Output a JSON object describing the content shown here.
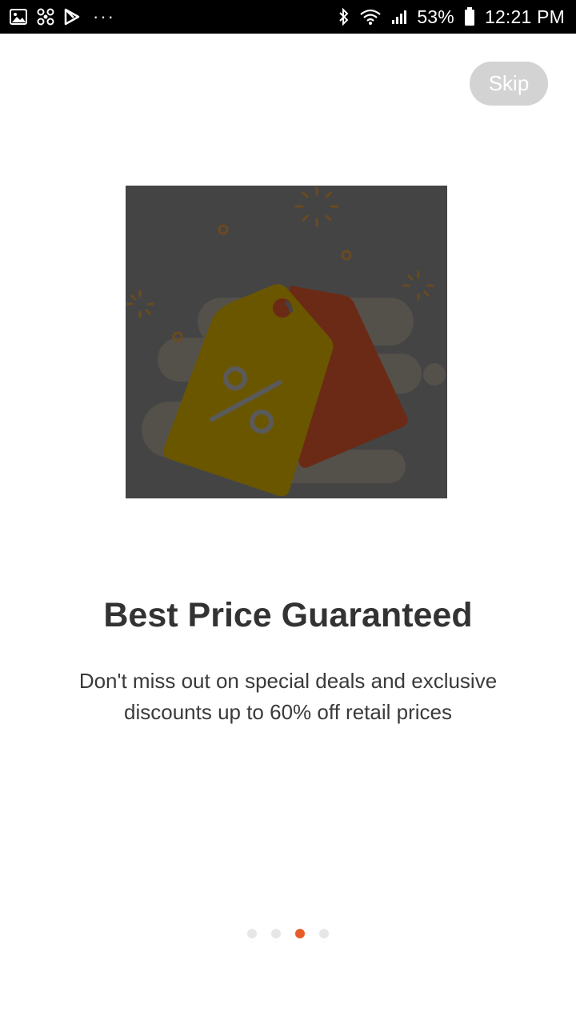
{
  "status_bar": {
    "battery_percent": "53%",
    "time": "12:21 PM",
    "more_indicator": "···",
    "left_icons": [
      "gallery-icon",
      "fan-icon",
      "play-store-icon"
    ],
    "right_icons": [
      "bluetooth-icon",
      "wifi-icon",
      "signal-icon",
      "battery-icon"
    ]
  },
  "onboarding": {
    "skip_label": "Skip",
    "title": "Best Price Guaranteed",
    "description_line1": "Don't miss out on special deals and exclusive",
    "description_line2": "discounts up to 60% off retail prices",
    "illustration_icon": "price-tags-icon",
    "page_count": 4,
    "current_page": 3
  },
  "colors": {
    "accent": "#e85c2a",
    "dot_inactive": "#e6e6e6",
    "skip_bg": "#d3d3d3",
    "title": "#333333"
  }
}
